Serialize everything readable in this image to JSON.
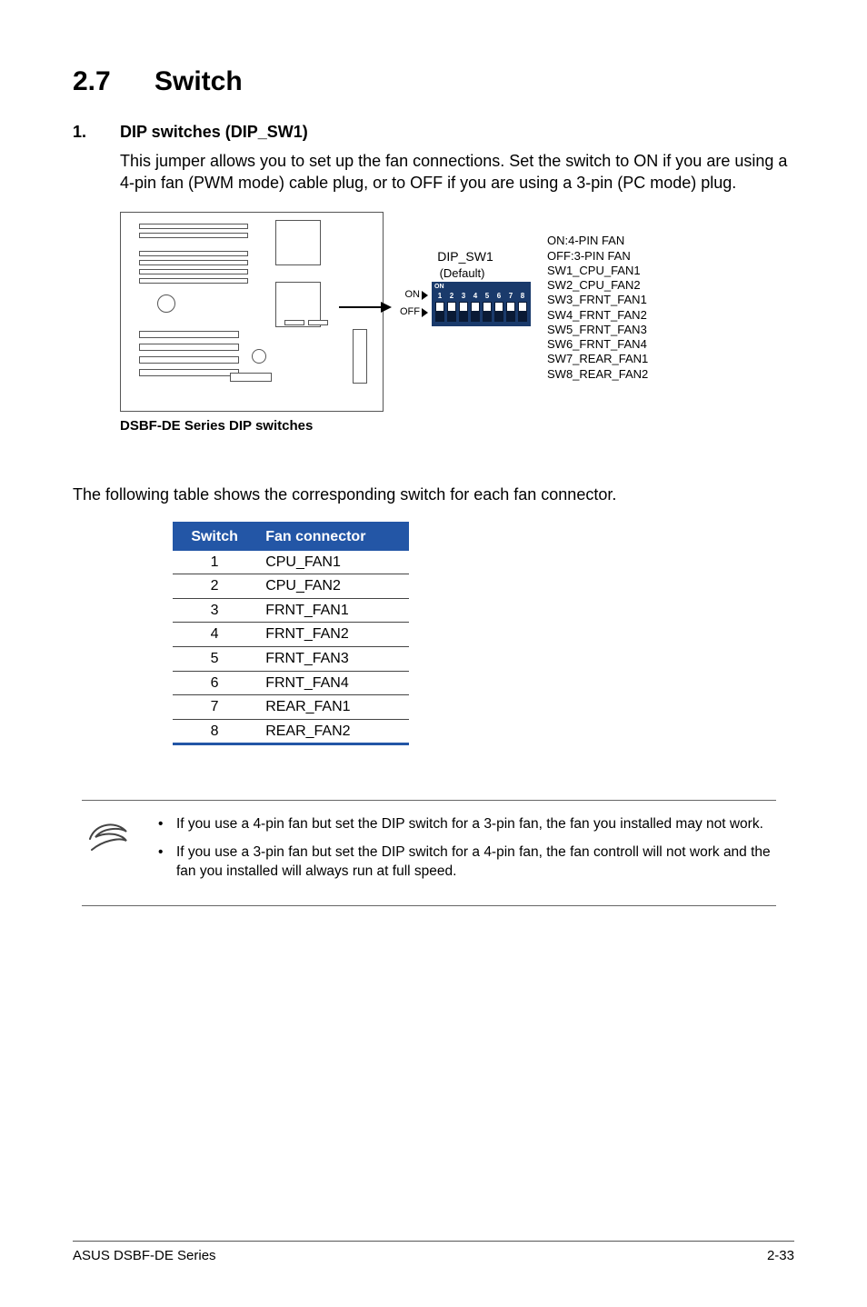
{
  "section": {
    "number": "2.7",
    "title": "Switch"
  },
  "item": {
    "number": "1.",
    "title": "DIP switches (DIP_SW1)",
    "body": "This jumper allows you to set up the fan connections. Set the switch to ON if you are using a 4-pin fan (PWM mode) cable plug, or to OFF if you are using a 3-pin (PC mode) plug."
  },
  "diagram": {
    "caption": "DSBF-DE Series DIP switches",
    "dip_title": "DIP_SW1",
    "default_label": "(Default)",
    "on_label": "ON",
    "off_label": "OFF",
    "dip_on_text": "ON",
    "switch_numbers": [
      "1",
      "2",
      "3",
      "4",
      "5",
      "6",
      "7",
      "8"
    ],
    "switch_default_state": [
      "on",
      "on",
      "on",
      "on",
      "on",
      "on",
      "on",
      "on"
    ],
    "legend_lines": [
      "ON:4-PIN FAN",
      "OFF:3-PIN FAN",
      "SW1_CPU_FAN1",
      "SW2_CPU_FAN2",
      "SW3_FRNT_FAN1",
      "SW4_FRNT_FAN2",
      "SW5_FRNT_FAN3",
      "SW6_FRNT_FAN4",
      "SW7_REAR_FAN1",
      "SW8_REAR_FAN2"
    ]
  },
  "table_intro": "The following table shows the corresponding switch for each fan connector.",
  "table": {
    "headers": [
      "Switch",
      "Fan connector"
    ],
    "rows": [
      [
        "1",
        "CPU_FAN1"
      ],
      [
        "2",
        "CPU_FAN2"
      ],
      [
        "3",
        "FRNT_FAN1"
      ],
      [
        "4",
        "FRNT_FAN2"
      ],
      [
        "5",
        "FRNT_FAN3"
      ],
      [
        "6",
        "FRNT_FAN4"
      ],
      [
        "7",
        "REAR_FAN1"
      ],
      [
        "8",
        "REAR_FAN2"
      ]
    ]
  },
  "notes": [
    "If you use a 4-pin fan but set the DIP switch for a 3-pin fan, the fan you installed may not work.",
    "If you use a 3-pin fan but set the DIP switch for a 4-pin fan, the fan controll will not work and the fan you installed will always run at full speed."
  ],
  "footer": {
    "left": "ASUS DSBF-DE Series",
    "right": "2-33"
  }
}
